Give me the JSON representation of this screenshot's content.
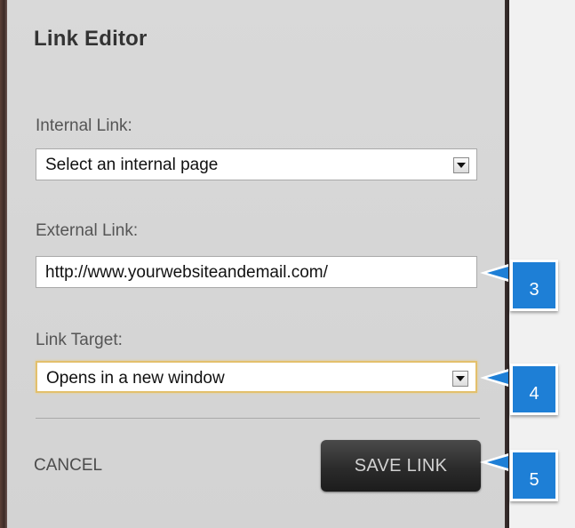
{
  "dialog": {
    "title": "Link Editor",
    "internal": {
      "label": "Internal Link:",
      "selected": "Select an internal page"
    },
    "external": {
      "label": "External Link:",
      "value": "http://www.yourwebsiteandemail.com/"
    },
    "target": {
      "label": "Link Target:",
      "selected": "Opens in a new window"
    },
    "cancel_label": "CANCEL",
    "save_label": "SAVE LINK"
  },
  "callouts": [
    {
      "number": "3"
    },
    {
      "number": "4"
    },
    {
      "number": "5"
    }
  ],
  "colors": {
    "callout": "#1e7fd6",
    "focus_border": "#e3c06c",
    "save_button": "#2b2b2b"
  }
}
